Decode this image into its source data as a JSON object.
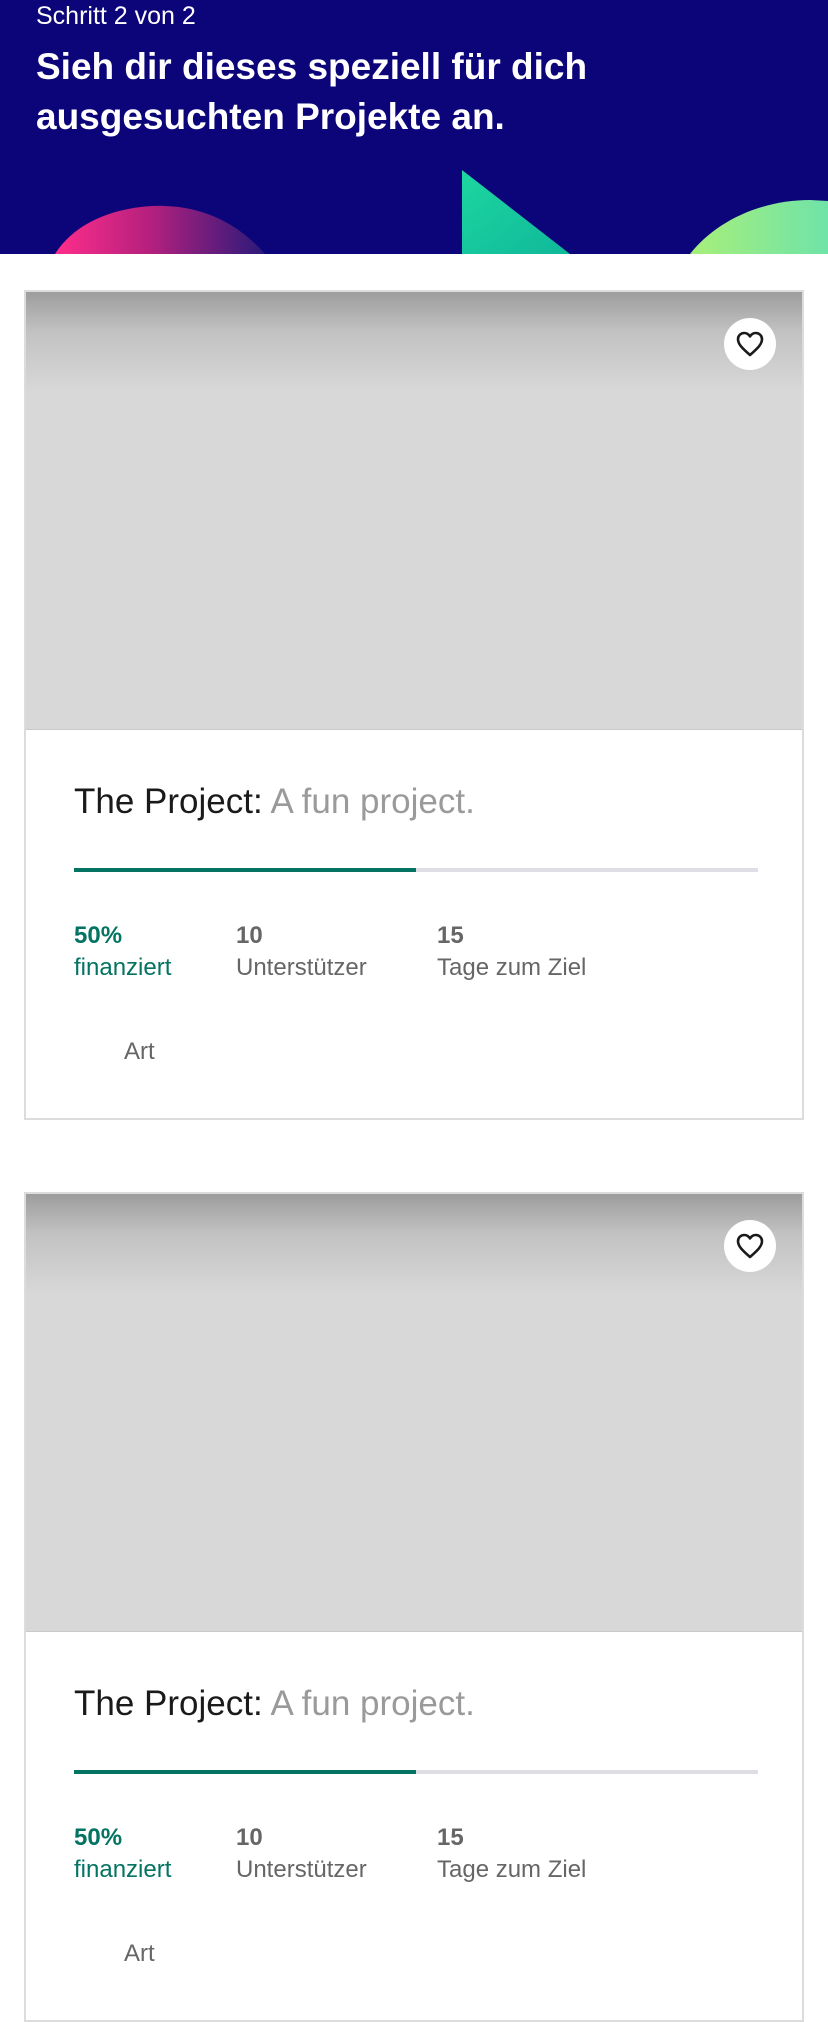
{
  "header": {
    "step": "Schritt 2 von 2",
    "title": "Sieh dir dieses speziell für dich ausgesuchten Projekte an.",
    "background_color": "#0c0479"
  },
  "colors": {
    "accent_green": "#037362",
    "progress_track": "#dedee4",
    "placeholder_image": "#d8d8d8",
    "muted_text": "#666666",
    "blurb_text": "#9a9a9a"
  },
  "projects": [
    {
      "name": "The Project:",
      "blurb": "A fun project.",
      "percent_funded": 50,
      "funded_value": "50%",
      "funded_label": "finanziert",
      "backers_value": "10",
      "backers_label": "Unterstützer",
      "days_value": "15",
      "days_label": "Tage zum Ziel",
      "category": "Art",
      "save_icon": "heart-icon"
    },
    {
      "name": "The Project:",
      "blurb": "A fun project.",
      "percent_funded": 50,
      "funded_value": "50%",
      "funded_label": "finanziert",
      "backers_value": "10",
      "backers_label": "Unterstützer",
      "days_value": "15",
      "days_label": "Tage zum Ziel",
      "category": "Art",
      "save_icon": "heart-icon"
    }
  ]
}
